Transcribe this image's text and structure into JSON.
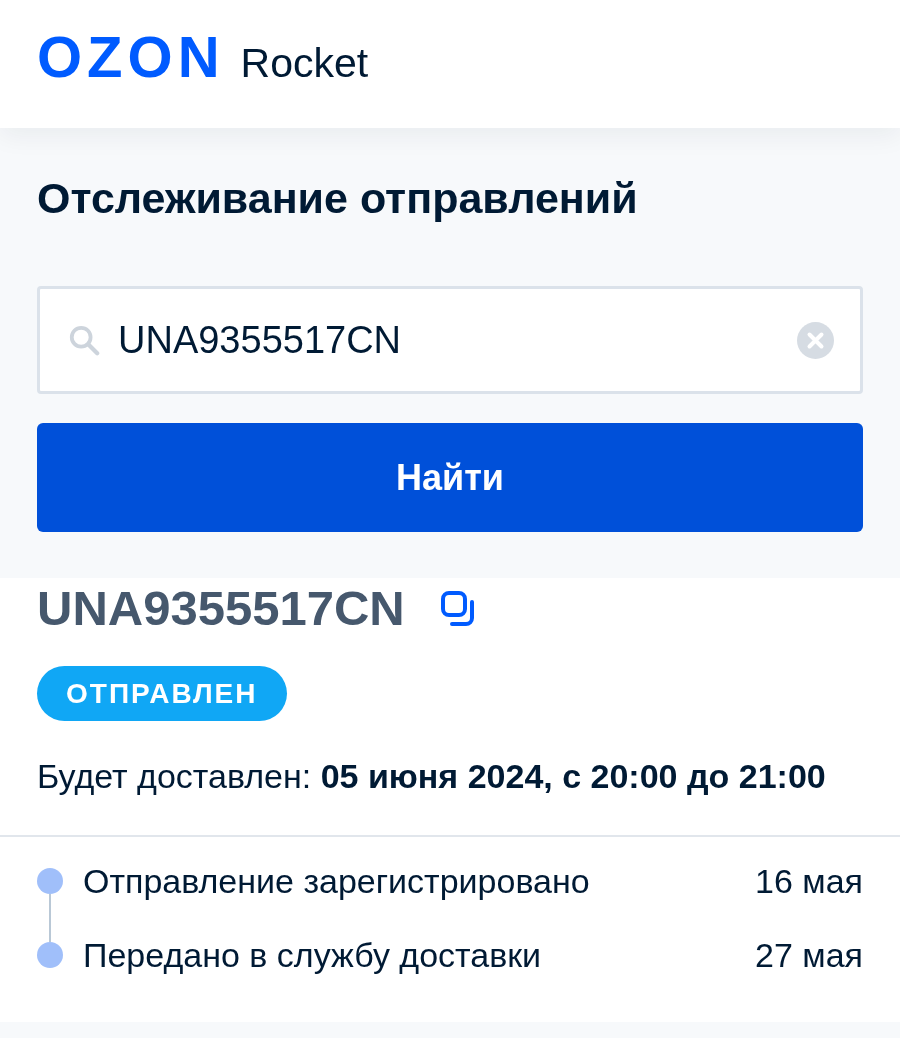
{
  "header": {
    "logo": {
      "brand": "OZON",
      "product": "Rocket"
    }
  },
  "search_panel": {
    "title": "Отслеживание отправлений",
    "search_field": {
      "value": "UNA9355517CN"
    },
    "button": "Найти"
  },
  "shipment": {
    "tracking_number": "UNA9355517CN",
    "status": "ОТПРАВЛЕН",
    "delivery": "Будет доставлен: **05 июня 2024, с 20:00 до 21:00**"
  },
  "events": [
    {
      "label": "Отправление зарегистрировано",
      "date": "16 мая"
    },
    {
      "label": "Передано в службу доставки",
      "date": "27 мая"
    }
  ]
}
